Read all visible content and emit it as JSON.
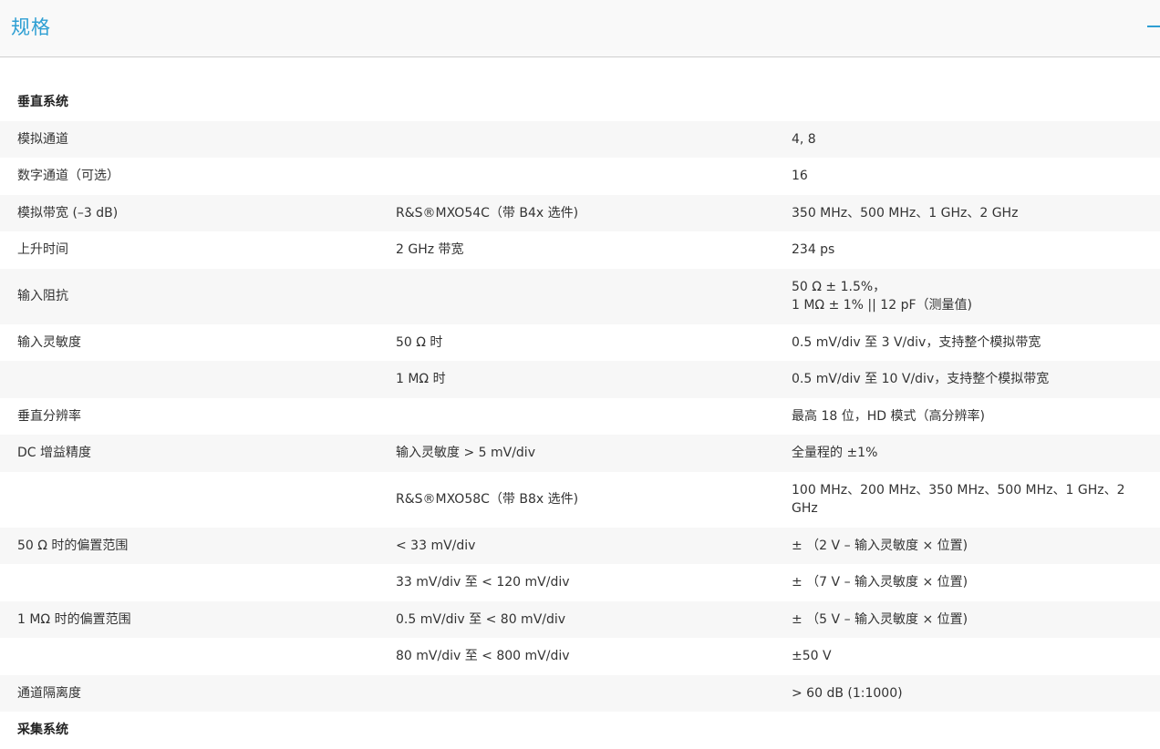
{
  "header": {
    "title": "规格"
  },
  "table": {
    "rows": [
      {
        "type": "section",
        "c1": "垂直系统"
      },
      {
        "c1": "模拟通道",
        "c2": "",
        "c3": "4, 8"
      },
      {
        "c1": "数字通道（可选）",
        "c2": "",
        "c3": "16"
      },
      {
        "c1": "模拟带宽 (–3 dB)",
        "c2": "R&S®MXO54C（带 B4x 选件)",
        "c3": "350 MHz、500 MHz、1 GHz、2 GHz"
      },
      {
        "c1": "上升时间",
        "c2": "2 GHz 带宽",
        "c3": "234 ps"
      },
      {
        "c1": "输入阻抗",
        "c2": "",
        "c3_line1": "50 Ω ± 1.5%，",
        "c3_line2": "1 MΩ ± 1% || 12 pF（测量值)"
      },
      {
        "c1": "输入灵敏度",
        "c2": "50 Ω 时",
        "c3": "0.5 mV/div 至 3 V/div，支持整个模拟带宽"
      },
      {
        "c1": "",
        "c2": "1 MΩ 时",
        "c3": "0.5 mV/div 至 10 V/div，支持整个模拟带宽"
      },
      {
        "c1": "垂直分辨率",
        "c2": "",
        "c3": "最高 18 位，HD 模式（高分辨率)"
      },
      {
        "c1": "DC 增益精度",
        "c2": "输入灵敏度 > 5 mV/div",
        "c3": "全量程的 ±1%"
      },
      {
        "c1": "",
        "c2": "R&S®MXO58C（带 B8x 选件)",
        "c3_line1": "100 MHz、200 MHz、350 MHz、500 MHz、1 GHz、2",
        "c3_line2": "GHz"
      },
      {
        "c1": "50 Ω 时的偏置范围",
        "c2": "< 33 mV/div",
        "c3": "± （2 V – 输入灵敏度 × 位置)"
      },
      {
        "c1": "",
        "c2": "33 mV/div 至 < 120 mV/div",
        "c3": "± （7 V – 输入灵敏度 × 位置)"
      },
      {
        "c1": "1 MΩ 时的偏置范围",
        "c2": "0.5 mV/div 至 < 80 mV/div",
        "c3": "± （5 V – 输入灵敏度 × 位置)"
      },
      {
        "c1": "",
        "c2": "80 mV/div 至 < 800 mV/div",
        "c3": "±50 V"
      },
      {
        "c1": "通道隔离度",
        "c2": "",
        "c3": "> 60 dB (1:1000)"
      },
      {
        "type": "section",
        "c1": "采集系统"
      }
    ]
  },
  "colors": {
    "accent": "#2e9fd3",
    "row_alt": "#f7f7f7",
    "text": "#333333"
  }
}
